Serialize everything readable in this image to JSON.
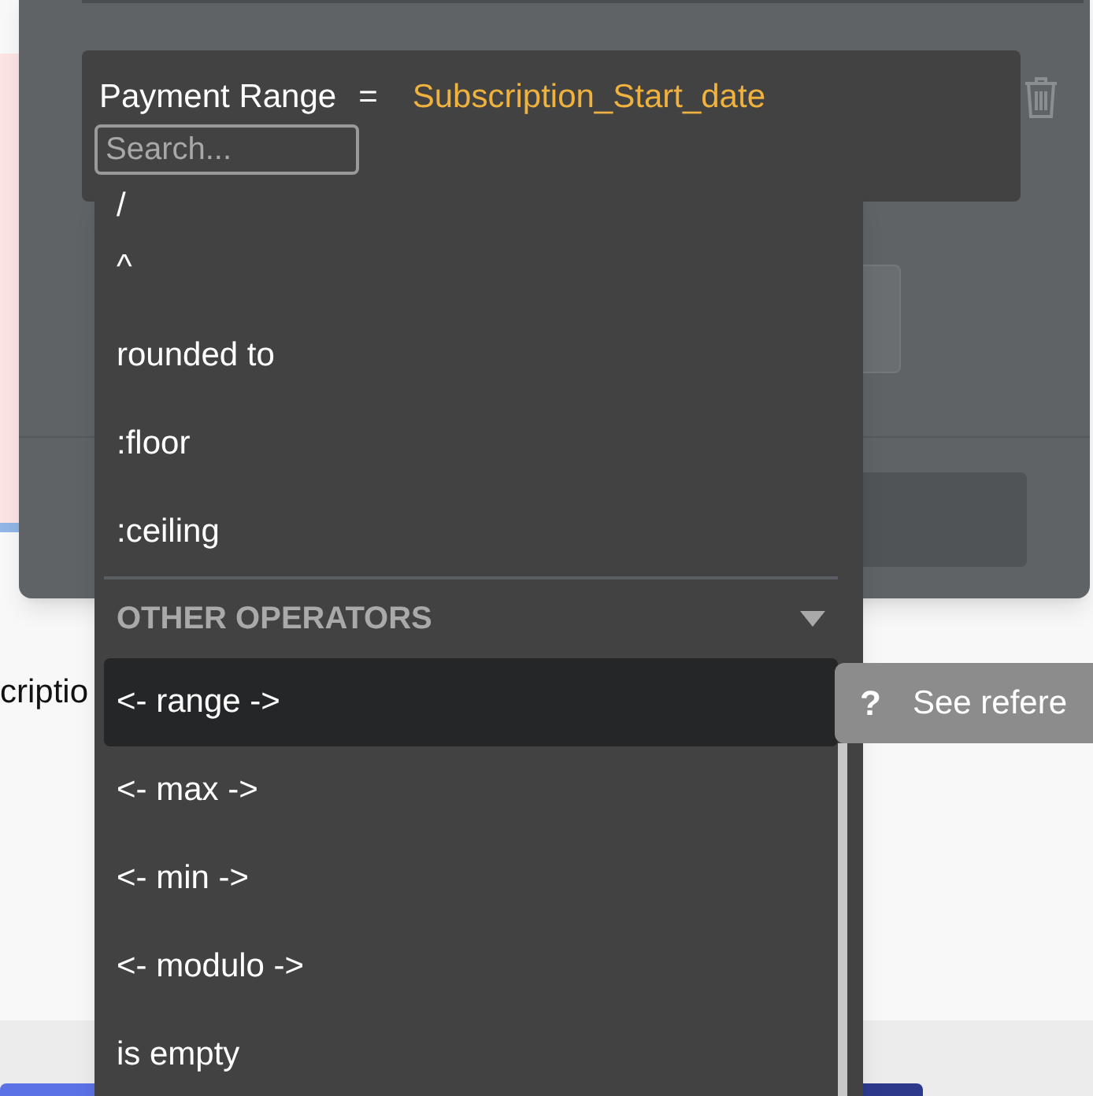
{
  "page": {
    "cut_text": "criptio"
  },
  "expression": {
    "field": "Payment Range",
    "operator": "=",
    "value": "Subscription_Start_date",
    "search": {
      "placeholder": "Search..."
    }
  },
  "dropdown": {
    "items": [
      {
        "kind": "item",
        "label": "/",
        "selected": false
      },
      {
        "kind": "item",
        "label": "^",
        "selected": false
      },
      {
        "kind": "item",
        "label": "rounded to",
        "selected": false
      },
      {
        "kind": "item",
        "label": ":floor",
        "selected": false
      },
      {
        "kind": "item",
        "label": ":ceiling",
        "selected": false
      },
      {
        "kind": "header",
        "label": "OTHER OPERATORS",
        "expanded": true
      },
      {
        "kind": "item",
        "label": "<- range ->",
        "selected": true
      },
      {
        "kind": "item",
        "label": "<- max ->",
        "selected": false
      },
      {
        "kind": "item",
        "label": "<- min ->",
        "selected": false
      },
      {
        "kind": "item",
        "label": "<- modulo ->",
        "selected": false
      },
      {
        "kind": "item",
        "label": "is empty",
        "selected": false
      }
    ]
  },
  "tooltip": {
    "icon": "?",
    "label": "See refere"
  }
}
